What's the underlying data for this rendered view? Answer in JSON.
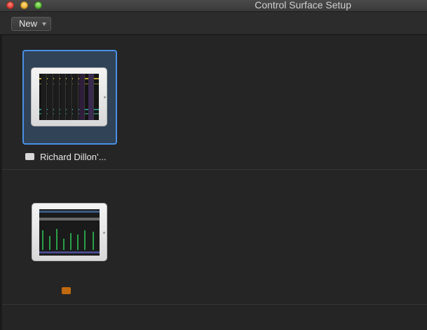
{
  "window": {
    "title": "Control Surface Setup"
  },
  "toolbar": {
    "new_label": "New"
  },
  "devices": [
    {
      "name": "Richard Dillon’...",
      "selected": true,
      "chip_color": "#d8d8d8"
    },
    {
      "name": "",
      "selected": false,
      "chip_color": "#c06a10"
    }
  ],
  "colors": {
    "selection": "#4a8fe6",
    "background": "#252525"
  }
}
